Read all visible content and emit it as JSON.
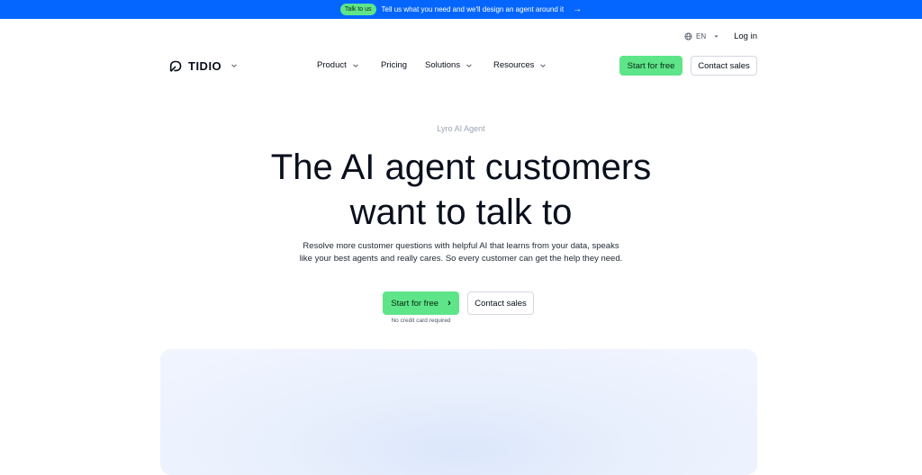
{
  "announcement": {
    "badge": "Talk to us",
    "message": "Tell us what you need and we'll design an agent around it",
    "arrow": "→",
    "bg_color": "#0566ff",
    "badge_color": "#5ee58a"
  },
  "utility": {
    "language": "EN",
    "login": "Log in"
  },
  "nav": {
    "brand": "TIDIO",
    "menu": [
      {
        "label": "Product",
        "has_dropdown": true
      },
      {
        "label": "Pricing",
        "has_dropdown": false
      },
      {
        "label": "Solutions",
        "has_dropdown": true
      },
      {
        "label": "Resources",
        "has_dropdown": true
      }
    ],
    "start_free": "Start for free",
    "contact_sales": "Contact sales"
  },
  "hero": {
    "eyebrow": "Lyro AI Agent",
    "title_line1": "The AI agent customers",
    "title_line2": "want to talk to",
    "subtitle_line1": "Resolve more customer questions with helpful AI that learns from your data, speaks",
    "subtitle_line2": "like your best agents and really cares. So every customer can get the help they need.",
    "start_free": "Start for free",
    "start_free_icon": "›",
    "contact_sales": "Contact sales",
    "no_credit_card": "No credit card required"
  },
  "colors": {
    "accent_green": "#5ee58a",
    "text_dark": "#0a0f1c",
    "muted": "#9aa3b2"
  }
}
